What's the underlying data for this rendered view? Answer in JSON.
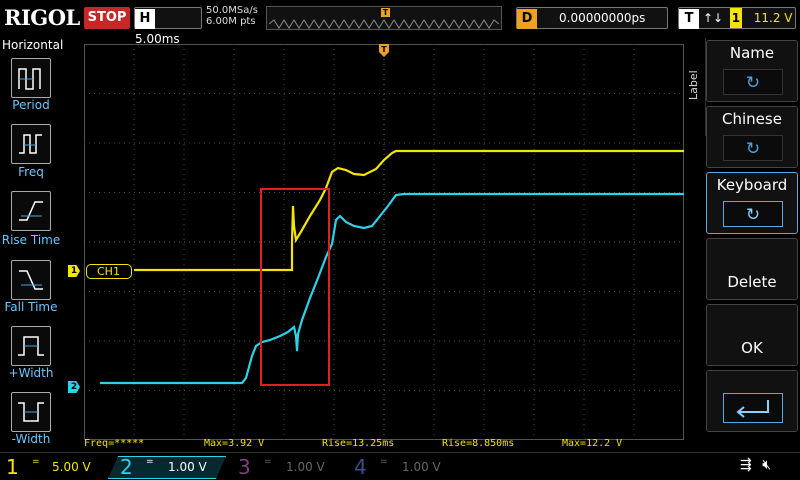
{
  "header": {
    "logo": "RIGOL",
    "run_state": "STOP",
    "timebase_letter": "H",
    "timebase_value": "5.00ms",
    "sample_rate": "50.0MSa/s",
    "memory_depth": "6.00M pts",
    "trigger_marker": "T",
    "delay_letter": "D",
    "delay_value": "0.00000000ps",
    "trigger_letter": "T",
    "trigger_edge": "↑↓",
    "trigger_source": "1",
    "trigger_level": "11.2 V"
  },
  "left_panel": {
    "title": "Horizontal",
    "items": [
      {
        "label": "Period",
        "icon": "period-icon"
      },
      {
        "label": "Freq",
        "icon": "freq-icon"
      },
      {
        "label": "Rise Time",
        "icon": "rise-time-icon"
      },
      {
        "label": "Fall Time",
        "icon": "fall-time-icon"
      },
      {
        "label": "+Width",
        "icon": "pos-width-icon"
      },
      {
        "label": "-Width",
        "icon": "neg-width-icon"
      }
    ]
  },
  "right_panel": {
    "tab_label": "Label",
    "softkeys": [
      {
        "label": "Name",
        "knob": "↻",
        "selected": false
      },
      {
        "label": "Chinese",
        "knob": "↻",
        "selected": false
      },
      {
        "label": "Keyboard",
        "knob": "↻",
        "selected": true
      },
      {
        "label": "Delete"
      },
      {
        "label": "OK"
      },
      {
        "label": "",
        "icon": "enter-icon"
      }
    ]
  },
  "channels_on_screen": {
    "ch1_marker": "1",
    "ch1_label": "CH1",
    "ch2_marker": "2"
  },
  "measurements": [
    {
      "text": "Freq=*****"
    },
    {
      "text": "Max=3.92 V"
    },
    {
      "text": "Rise=13.25ms"
    },
    {
      "text": "Rise=8.850ms"
    },
    {
      "text": "Max=12.2 V"
    }
  ],
  "bottom_bar": {
    "channels": [
      {
        "num": "1",
        "coupling": "=",
        "scale": "5.00 V",
        "color": "#f5e400"
      },
      {
        "num": "2",
        "coupling": "=",
        "scale": "1.00 V",
        "color": "#2ad4e8"
      },
      {
        "num": "3",
        "coupling": "=",
        "scale": "1.00 V",
        "color": "#7a3f7a"
      },
      {
        "num": "4",
        "coupling": "=",
        "scale": "1.00 V",
        "color": "#3a4f8a"
      }
    ],
    "icons": [
      "usb-icon",
      "speaker-muted-icon"
    ]
  },
  "colors": {
    "ch1": "#f5e400",
    "ch2": "#2ad4e8",
    "trigger": "#f0a020",
    "stop": "#c62828",
    "highlight_box": "#e02020"
  }
}
